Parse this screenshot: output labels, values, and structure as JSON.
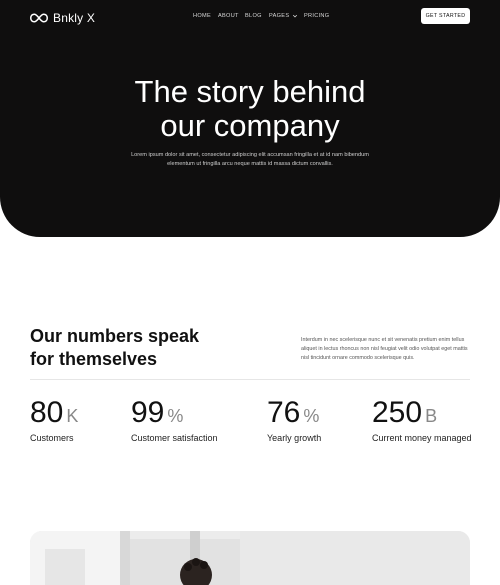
{
  "brand": {
    "name": "Bnkly X",
    "logo_icon": "infinity-icon"
  },
  "nav": {
    "items": [
      "HOME",
      "ABOUT",
      "BLOG",
      "PAGES",
      "PRICING"
    ],
    "cta_label": "GET STARTED"
  },
  "hero": {
    "title_line1": "The story behind",
    "title_line2": "our company",
    "subtitle": "Lorem ipsum dolor sit amet, consectetur adipiscing elit accumsan fringilla et at id nam bibendum elementum ut fringilla arcu neque mattis id massa dictum convallis."
  },
  "numbers": {
    "title_line1": "Our numbers speak",
    "title_line2": "for themselves",
    "description": "Interdum in nec scelerisque nunc et sit venenatis pretium enim tellus aliquet in lectus rhoncus non nisl feugiat velit odio volutpat eget mattis nisl tincidunt ornare commodo scelerisque quis.",
    "stats": [
      {
        "value": "80",
        "unit": "K",
        "label": "Customers"
      },
      {
        "value": "99",
        "unit": "%",
        "label": "Customer satisfaction"
      },
      {
        "value": "76",
        "unit": "%",
        "label": "Yearly growth"
      },
      {
        "value": "250",
        "unit": "B",
        "label": "Current money managed"
      }
    ]
  },
  "colors": {
    "hero_bg": "#0f0e0e",
    "text_dark": "#111111",
    "unit_gray": "#888888"
  }
}
